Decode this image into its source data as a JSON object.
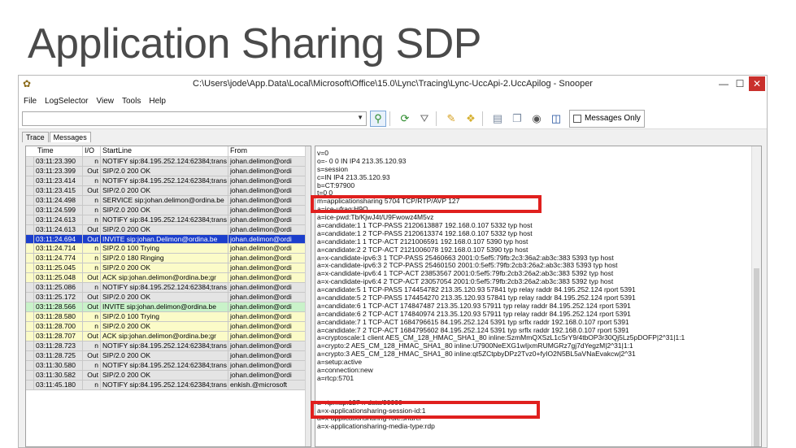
{
  "slide": {
    "title": "Application Sharing SDP"
  },
  "window": {
    "title": "C:\\Users\\jode\\App.Data\\Local\\Microsoft\\Office\\15.0\\Lync\\Tracing\\Lync-UccApi-2.UccApilog - Snooper",
    "controls": {
      "minimize": "—",
      "maximize": "☐",
      "close": "✕"
    }
  },
  "menu": [
    "File",
    "LogSelector",
    "View",
    "Tools",
    "Help"
  ],
  "toolbar": {
    "combo_value": "",
    "combo_arrow": "▼",
    "messages_only_label": "Messages Only",
    "icons": [
      "search-icon",
      "refresh-icon",
      "filter-icon",
      "marker-icon",
      "bookmark-icon",
      "page-icon",
      "copy-icon",
      "sync-icon",
      "layout-icon"
    ]
  },
  "tabs": [
    "Trace",
    "Messages"
  ],
  "columns": [
    "Time",
    "I/O",
    "StartLine",
    "From"
  ],
  "rows": [
    {
      "time": "03:11:23.390",
      "io": "n",
      "start": "NOTIFY sip:84.195.252.124:62384;trans",
      "from": "johan.delimon@ordi",
      "style": "gray"
    },
    {
      "time": "03:11:23.399",
      "io": "Out",
      "start": "SIP/2.0 200 OK",
      "from": "johan.delimon@ordi",
      "style": "gray"
    },
    {
      "time": "03:11:23.414",
      "io": "n",
      "start": "NOTIFY sip:84.195.252.124:62384;trans",
      "from": "johan.delimon@ordi",
      "style": "gray"
    },
    {
      "time": "03:11:23.415",
      "io": "Out",
      "start": "SIP/2.0 200 OK",
      "from": "johan.delimon@ordi",
      "style": "gray"
    },
    {
      "time": "03:11:24.498",
      "io": "n",
      "start": "SERVICE sip:johan.delimon@ordina.be",
      "from": "johan.delimon@ordi",
      "style": "gray"
    },
    {
      "time": "03:11:24.599",
      "io": "n",
      "start": "SIP/2.0 200 OK",
      "from": "johan.delimon@ordi",
      "style": "gray"
    },
    {
      "time": "03:11:24.613",
      "io": "n",
      "start": "NOTIFY sip:84.195.252.124:62384;trans",
      "from": "johan.delimon@ordi",
      "style": "gray"
    },
    {
      "time": "03:11:24.613",
      "io": "Out",
      "start": "SIP/2.0 200 OK",
      "from": "johan.delimon@ordi",
      "style": "gray"
    },
    {
      "time": "03:11:24.694",
      "io": "Out",
      "start": "INVITE sip:johan.Delimon@ordina.be",
      "from": "johan.delimon@ordi",
      "style": "sel"
    },
    {
      "time": "03:11:24.714",
      "io": "n",
      "start": "SIP/2.0 100 Trying",
      "from": "johan.delimon@ordi",
      "style": "yellow"
    },
    {
      "time": "03:11:24.774",
      "io": "n",
      "start": "SIP/2.0 180 Ringing",
      "from": "johan.delimon@ordi",
      "style": "yellow"
    },
    {
      "time": "03:11:25.045",
      "io": "n",
      "start": "SIP/2.0 200 OK",
      "from": "johan.delimon@ordi",
      "style": "yellow"
    },
    {
      "time": "03:11:25.048",
      "io": "Out",
      "start": "ACK sip:johan.delimon@ordina.be;gr",
      "from": "johan.delimon@ordi",
      "style": "yellow"
    },
    {
      "time": "03:11:25.086",
      "io": "n",
      "start": "NOTIFY sip:84.195.252.124:62384;trans",
      "from": "johan.delimon@ordi",
      "style": "gray"
    },
    {
      "time": "03:11:25.172",
      "io": "Out",
      "start": "SIP/2.0 200 OK",
      "from": "johan.delimon@ordi",
      "style": "gray"
    },
    {
      "time": "03:11:28.566",
      "io": "Out",
      "start": "INVITE sip:johan.delimon@ordina.be",
      "from": "johan.delimon@ordi",
      "style": "green"
    },
    {
      "time": "03:11:28.580",
      "io": "n",
      "start": "SIP/2.0 100 Trying",
      "from": "johan.delimon@ordi",
      "style": "yellow"
    },
    {
      "time": "03:11:28.700",
      "io": "n",
      "start": "SIP/2.0 200 OK",
      "from": "johan.delimon@ordi",
      "style": "yellow"
    },
    {
      "time": "03:11:28.707",
      "io": "Out",
      "start": "ACK sip:johan.delimon@ordina.be;gr",
      "from": "johan.delimon@ordi",
      "style": "yellow"
    },
    {
      "time": "03:11:28.723",
      "io": "n",
      "start": "NOTIFY sip:84.195.252.124:62384;trans",
      "from": "johan.delimon@ordi",
      "style": "gray"
    },
    {
      "time": "03:11:28.725",
      "io": "Out",
      "start": "SIP/2.0 200 OK",
      "from": "johan.delimon@ordi",
      "style": "gray"
    },
    {
      "time": "03:11:30.580",
      "io": "n",
      "start": "NOTIFY sip:84.195.252.124:62384;trans",
      "from": "johan.delimon@ordi",
      "style": "gray"
    },
    {
      "time": "03:11:30.582",
      "io": "Out",
      "start": "SIP/2.0 200 OK",
      "from": "johan.delimon@ordi",
      "style": "gray"
    },
    {
      "time": "03:11:45.180",
      "io": "n",
      "start": "NOTIFY sip:84.195.252.124:62384;trans",
      "from": "enkish.@microsoft",
      "style": "gray"
    }
  ],
  "sdp_lines": [
    "v=0",
    "o=- 0 0 IN IP4 213.35.120.93",
    "s=session",
    "c=IN IP4 213.35.120.93",
    "b=CT:97900",
    "t=0 0",
    "m=applicationsharing 5704 TCP/RTP/AVP 127",
    "a=ice-ufrag:H9Q",
    "a=ice-pwd:Tb/KjwJ4t/U9Fwowz4M5vz",
    "a=candidate:1 1 TCP-PASS 2120613887 192.168.0.107 5332 typ host",
    "a=candidate:1 2 TCP-PASS 2120613374 192.168.0.107 5332 typ host",
    "a=candidate:1 1 TCP-ACT 2121006591 192.168.0.107 5390 typ host",
    "a=candidate:2 2 TCP-ACT 2121006078 192.168.0.107 5390 typ host",
    "a=x-candidate-ipv6:3 1 TCP-PASS 25460663 2001:0:5ef5:79fb:2c3:36a2:ab3c:383 5393 typ host",
    "a=x-candidate-ipv6:3 2 TCP-PASS 25460150 2001:0:5ef5:79fb:2cb3:26a2:ab3c:383 5393 typ host",
    "a=x-candidate-ipv6:4 1 TCP-ACT 23853567 2001:0:5ef5:79fb:2cb3:26a2:ab3c:383 5392 typ host",
    "a=x-candidate-ipv6:4 2 TCP-ACT 23057054 2001:0:5ef5:79fb:2cb3:26a2:ab3c:383 5392 typ host",
    "a=candidate:5 1 TCP-PASS 174454782 213.35.120.93 57841 typ relay raddr 84.195.252.124 rport 5391",
    "a=candidate:5 2 TCP-PASS 174454270 213.35.120.93 57841 typ relay raddr 84.195.252.124 rport 5391",
    "a=candidate:6 1 TCP-ACT 174847487 213.35.120.93 57911 typ relay raddr 84.195.252.124 rport 5391",
    "a=candidate:6 2 TCP-ACT 174840974 213.35.120.93 57911 typ relay raddr 84.195.252.124 rport 5391",
    "a=candidate:7 1 TCP-ACT 1684796615 84.195.252.124 5391 typ srflx raddr 192.168.0.107 rport 5391",
    "a=candidate:7 2 TCP-ACT 1684795602 84.195.252.124 5391 typ srflx raddr 192.168.0.107 rport 5391",
    "a=cryptoscale:1 client AES_CM_128_HMAC_SHA1_80 inline:SzmMmQXSzL1cSrY9/4tbOP3r30Qj5Lz5pDOFP|2^31|1:1",
    "a=crypto:2 AES_CM_128_HMAC_SHA1_80 inline:U7900NeEXG1wIjxmRUMGRz7gj7dYegzM|2^31|1:1",
    "a=crypto:3 AES_CM_128_HMAC_SHA1_80 inline:qt5ZCtpbyDPz2Tvz0+fyIO2N5BL5aVNaEvakcw|2^31",
    "a=setup:active",
    "a=connection:new",
    "a=rtcp:5701",
    "",
    "",
    "a=rtpmap:127 x-data/90000",
    "a=x-applicationsharing-session-id:1",
    "a=x-applicationsharing-role:sharer",
    "a=x-applicationsharing-media-type:rdp"
  ]
}
